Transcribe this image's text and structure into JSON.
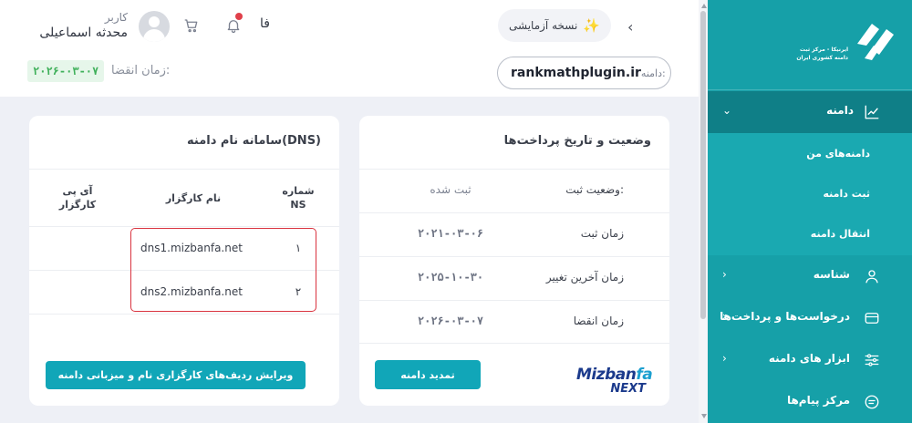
{
  "header": {
    "user_role": "کاربر",
    "user_name": "محدثه اسماعیلی",
    "language": "فا",
    "trial_label": "نسخه آزمایشی",
    "expire_label": "زمان انقضا:",
    "expire_value": "۲۰۲۶-۰۳-۰۷",
    "domain_label": "دامنه:",
    "domain_name": "rankmathplugin.ir"
  },
  "dns_card": {
    "title": "سامانه نام دامنه(DNS)",
    "columns": {
      "number": "شماره NS",
      "nameserver": "نام کارگزار",
      "ip": "آی پی کارگزار"
    },
    "rows": [
      {
        "number": "۱",
        "nameserver": "dns1.mizbanfa.net",
        "ip": ""
      },
      {
        "number": "۲",
        "nameserver": "dns2.mizbanfa.net",
        "ip": ""
      }
    ],
    "edit_button": "ویرایش ردیف‌های کارگزاری نام و میزبانی دامنه"
  },
  "status_card": {
    "title": "وضعیت و تاریخ پرداخت‌ها",
    "rows": [
      {
        "label": "وضعیت ثبت:",
        "value": "ثبت شده"
      },
      {
        "label": "زمان ثبت",
        "value": "۲۰۲۱-۰۳-۰۶"
      },
      {
        "label": "زمان آخرین تغییر",
        "value": "۲۰۲۵-۱۰-۳۰"
      },
      {
        "label": "زمان انقضا",
        "value": "۲۰۲۶-۰۳-۰۷"
      }
    ],
    "renew_button": "تمدید دامنه",
    "brand_top": "Mizban",
    "brand_top_accent": "fa",
    "brand_bottom": "NEXT"
  },
  "sidebar": {
    "logo_text": "ایرنیکا - مرکز ثبت دامنه کشوری ایران",
    "items": [
      {
        "label": "دامنه",
        "icon": "chart-icon"
      },
      {
        "label": "شناسه",
        "icon": "user-icon"
      },
      {
        "label": "درخواست‌ها و پرداخت‌ها",
        "icon": "card-icon"
      },
      {
        "label": "ابزار های دامنه",
        "icon": "sliders-icon"
      },
      {
        "label": "مرکز پیام‌ها",
        "icon": "message-icon"
      }
    ],
    "subitems": [
      {
        "label": "دامنه‌های من"
      },
      {
        "label": "ثبت دامنه"
      },
      {
        "label": "انتقال دامنه"
      }
    ]
  },
  "colors": {
    "sidebar": "#16a0a8",
    "sidebar_active": "#0f7f87",
    "button": "#11a6b8",
    "highlight": "#d9333f",
    "expire_badge_bg": "#e6f6ea",
    "expire_badge_text": "#3fb05a"
  }
}
